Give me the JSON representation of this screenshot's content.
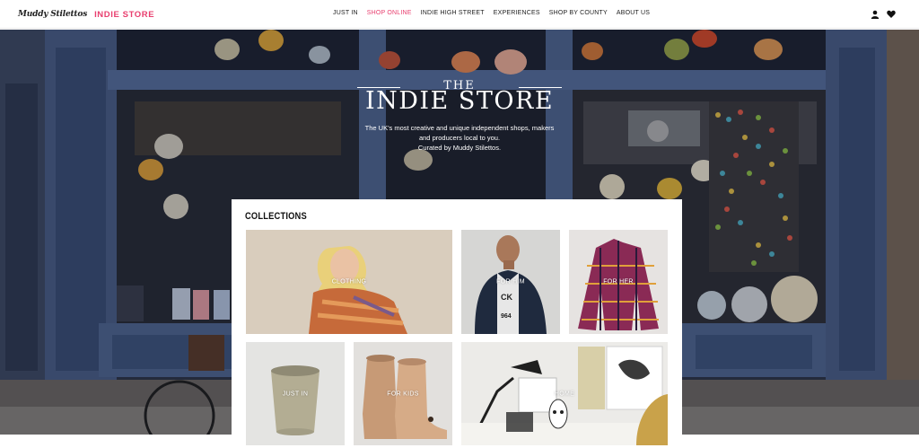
{
  "header": {
    "logo_script": "Muddy Stilettos",
    "logo_brand": "INDIE STORE",
    "nav": [
      {
        "label": "JUST IN",
        "active": false
      },
      {
        "label": "SHOP ONLINE",
        "active": true
      },
      {
        "label": "INDIE HIGH STREET",
        "active": false
      },
      {
        "label": "EXPERIENCES",
        "active": false
      },
      {
        "label": "SHOP BY COUNTY",
        "active": false
      },
      {
        "label": "ABOUT US",
        "active": false
      }
    ],
    "icons": [
      "user-icon",
      "heart-icon"
    ]
  },
  "hero": {
    "title_top": "THE",
    "title_main": "INDIE STORE",
    "desc_line1": "The UK's most creative and unique independent shops, makers",
    "desc_line2": "and producers local to you.",
    "desc_line3": "Curated by Muddy Stilettos."
  },
  "collections": {
    "title": "COLLECTIONS",
    "tiles": [
      {
        "label": "CLOTHING"
      },
      {
        "label": "FOR HIM"
      },
      {
        "label": "FOR HER"
      },
      {
        "label": "JUST IN"
      },
      {
        "label": "FOR KIDS"
      },
      {
        "label": "HOME"
      }
    ]
  },
  "colors": {
    "accent": "#e83e6e",
    "text": "#222222",
    "hero_overlay": "#1f2638"
  }
}
